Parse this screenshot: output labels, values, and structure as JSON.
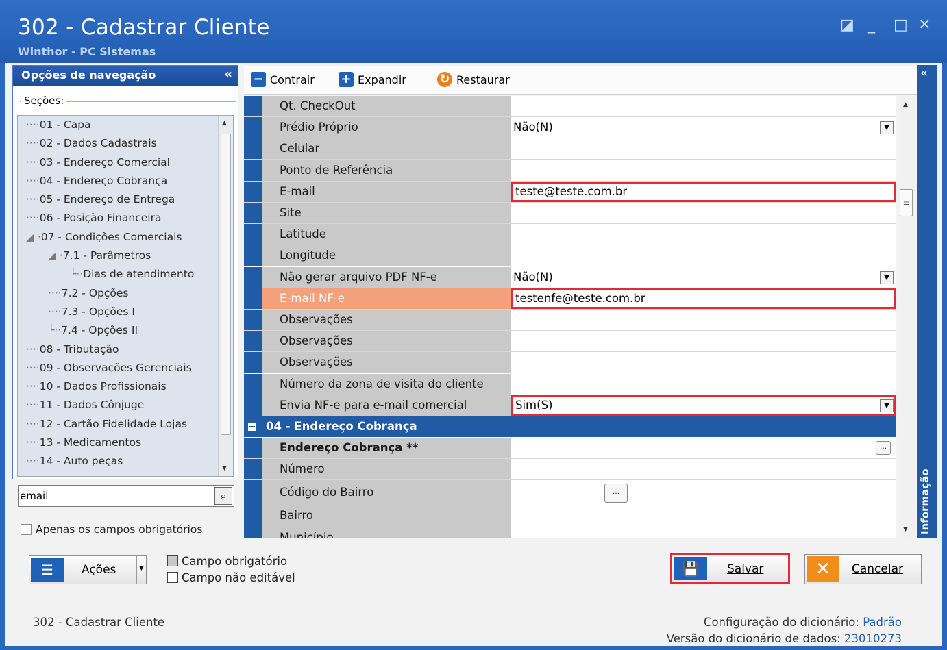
{
  "window": {
    "title": "302 - Cadastrar Cliente",
    "subtitle": "Winthor - PC Sistemas",
    "controls": [
      "◪",
      "_",
      "□",
      "✕"
    ]
  },
  "nav": {
    "header": "Opções de navegação",
    "collapse": "«",
    "sections_label": "Seções:",
    "items": [
      {
        "label": "01 - Capa",
        "prefix": "····",
        "indent": 0
      },
      {
        "label": "02 - Dados Cadastrais",
        "prefix": "····",
        "indent": 0
      },
      {
        "label": "03 - Endereço Comercial",
        "prefix": "····",
        "indent": 0
      },
      {
        "label": "04 - Endereço Cobrança",
        "prefix": "····",
        "indent": 0
      },
      {
        "label": "05 - Endereço de Entrega",
        "prefix": "····",
        "indent": 0
      },
      {
        "label": "06 - Posição Financeira",
        "prefix": "····",
        "indent": 0
      },
      {
        "label": "07 - Condições Comerciais",
        "prefix": "◢ ·",
        "indent": 0
      },
      {
        "label": "7.1 - Parâmetros",
        "prefix": "◢ ·",
        "indent": 1
      },
      {
        "label": "Dias de atendimento",
        "prefix": "└··",
        "indent": 2
      },
      {
        "label": "7.2 - Opções",
        "prefix": "····",
        "indent": 1
      },
      {
        "label": "7.3 - Opções I",
        "prefix": "····",
        "indent": 1
      },
      {
        "label": "7.4 - Opções II",
        "prefix": "└··",
        "indent": 1
      },
      {
        "label": "08 - Tributação",
        "prefix": "····",
        "indent": 0
      },
      {
        "label": "09 - Observações Gerenciais",
        "prefix": "····",
        "indent": 0
      },
      {
        "label": "10 - Dados Profissionais",
        "prefix": "····",
        "indent": 0
      },
      {
        "label": "11 - Dados Cônjuge",
        "prefix": "····",
        "indent": 0
      },
      {
        "label": "12 - Cartão Fidelidade Lojas",
        "prefix": "····",
        "indent": 0
      },
      {
        "label": "13 - Medicamentos",
        "prefix": "····",
        "indent": 0
      },
      {
        "label": "14 - Auto peças",
        "prefix": "····",
        "indent": 0
      }
    ],
    "search_value": "email",
    "search_icon": "magnifier-icon",
    "only_required_label": "Apenas os campos obrigatórios"
  },
  "toolbar": {
    "collapse_label": "Contrair",
    "expand_label": "Expandir",
    "restore_label": "Restaurar"
  },
  "grid": {
    "rows": [
      {
        "label": "Qt. CheckOut",
        "value": "",
        "type": "text"
      },
      {
        "label": "Prédio Próprio",
        "value": "Não(N)",
        "type": "select"
      },
      {
        "label": "Celular",
        "value": "",
        "type": "text"
      },
      {
        "label": "Ponto de Referência",
        "value": "",
        "type": "text"
      },
      {
        "label": "E-mail",
        "value": "teste@teste.com.br",
        "type": "text",
        "boxed": true
      },
      {
        "label": "Site",
        "value": "",
        "type": "text"
      },
      {
        "label": "Latitude",
        "value": "",
        "type": "text"
      },
      {
        "label": "Longitude",
        "value": "",
        "type": "text"
      },
      {
        "label": "Não gerar arquivo PDF NF-e",
        "value": "Não(N)",
        "type": "select"
      },
      {
        "label": "E-mail NF-e",
        "value": "testenfe@teste.com.br",
        "type": "text",
        "boxed": true,
        "highlight": true
      },
      {
        "label": "Observações",
        "value": "",
        "type": "text"
      },
      {
        "label": "Observações",
        "value": "",
        "type": "text"
      },
      {
        "label": "Observações",
        "value": "",
        "type": "text"
      },
      {
        "label": "Número da zona de visita do cliente",
        "value": "",
        "type": "text"
      },
      {
        "label": "Envia NF-e para e-mail comercial",
        "value": "Sim(S)",
        "type": "select",
        "boxed": true
      }
    ],
    "section2_title": "04 - Endereço Cobrança",
    "rows2": [
      {
        "label": "Endereço Cobrança **",
        "bold": true,
        "button": "right"
      },
      {
        "label": "Número"
      },
      {
        "label": "Código do Bairro",
        "button": "left"
      },
      {
        "label": "Bairro"
      },
      {
        "label": "Município"
      }
    ]
  },
  "info_panel": {
    "label": "Informação",
    "collapse": "«"
  },
  "footer": {
    "actions_label": "Ações",
    "legend_required": "Campo obrigatório",
    "legend_readonly": "Campo não editável",
    "save_label": "Salvar",
    "cancel_label": "Cancelar",
    "status_left": "302 - Cadastrar Cliente",
    "dict_config_label": "Configuração do dicionário:",
    "dict_config_value": "Padrão",
    "dict_version_label": "Versão do dicionário de dados:",
    "dict_version_value": "23010273"
  },
  "colors": {
    "accent": "#215ba5",
    "highlight": "#f4a07a",
    "required_box": "#e32b36"
  }
}
